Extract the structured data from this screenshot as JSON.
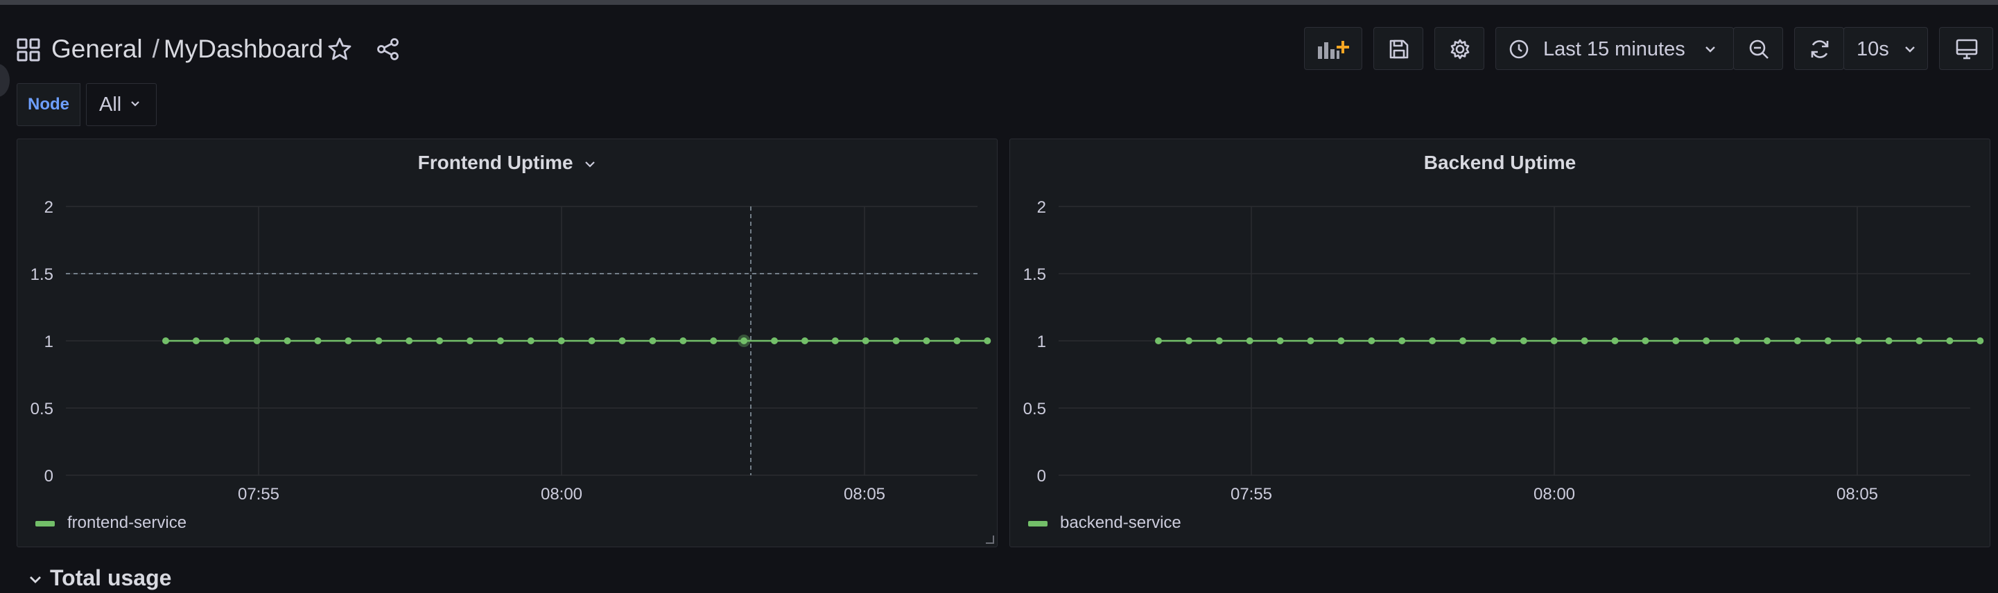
{
  "breadcrumb": {
    "folder": "General",
    "separator": "/",
    "dashboard": "MyDashboard"
  },
  "toolbar": {
    "time_range": "Last 15 minutes",
    "refresh_interval": "10s",
    "icons": [
      "add-panel-icon",
      "save-icon",
      "settings-icon",
      "clock-icon",
      "zoom-out-icon",
      "refresh-icon",
      "tv-mode-icon"
    ]
  },
  "variables": [
    {
      "label": "Node",
      "value": "All"
    }
  ],
  "panels": [
    {
      "title": "Frontend Uptime",
      "legend": "frontend-service",
      "chart_data": {
        "type": "line",
        "title": "Frontend Uptime",
        "x_ticks": [
          "07:55",
          "08:00",
          "08:05"
        ],
        "y_ticks": [
          "0",
          "0.5",
          "1",
          "1.5",
          "2"
        ],
        "ylim": [
          0,
          2
        ],
        "grid": true,
        "legend_position": "bottom-left",
        "series": [
          {
            "name": "frontend-service",
            "color": "#73bf69",
            "values": [
              1,
              1,
              1,
              1,
              1,
              1,
              1,
              1,
              1,
              1,
              1,
              1,
              1,
              1,
              1,
              1,
              1,
              1,
              1,
              1,
              1,
              1,
              1,
              1,
              1,
              1,
              1,
              1
            ]
          }
        ],
        "crosshair": {
          "y": 1.5
        }
      }
    },
    {
      "title": "Backend Uptime",
      "legend": "backend-service",
      "chart_data": {
        "type": "line",
        "title": "Backend Uptime",
        "x_ticks": [
          "07:55",
          "08:00",
          "08:05"
        ],
        "y_ticks": [
          "0",
          "0.5",
          "1",
          "1.5",
          "2"
        ],
        "ylim": [
          0,
          2
        ],
        "grid": true,
        "legend_position": "bottom-left",
        "series": [
          {
            "name": "backend-service",
            "color": "#73bf69",
            "values": [
              1,
              1,
              1,
              1,
              1,
              1,
              1,
              1,
              1,
              1,
              1,
              1,
              1,
              1,
              1,
              1,
              1,
              1,
              1,
              1,
              1,
              1,
              1,
              1,
              1,
              1,
              1,
              1
            ]
          }
        ]
      }
    }
  ],
  "row": {
    "title": "Total usage"
  }
}
